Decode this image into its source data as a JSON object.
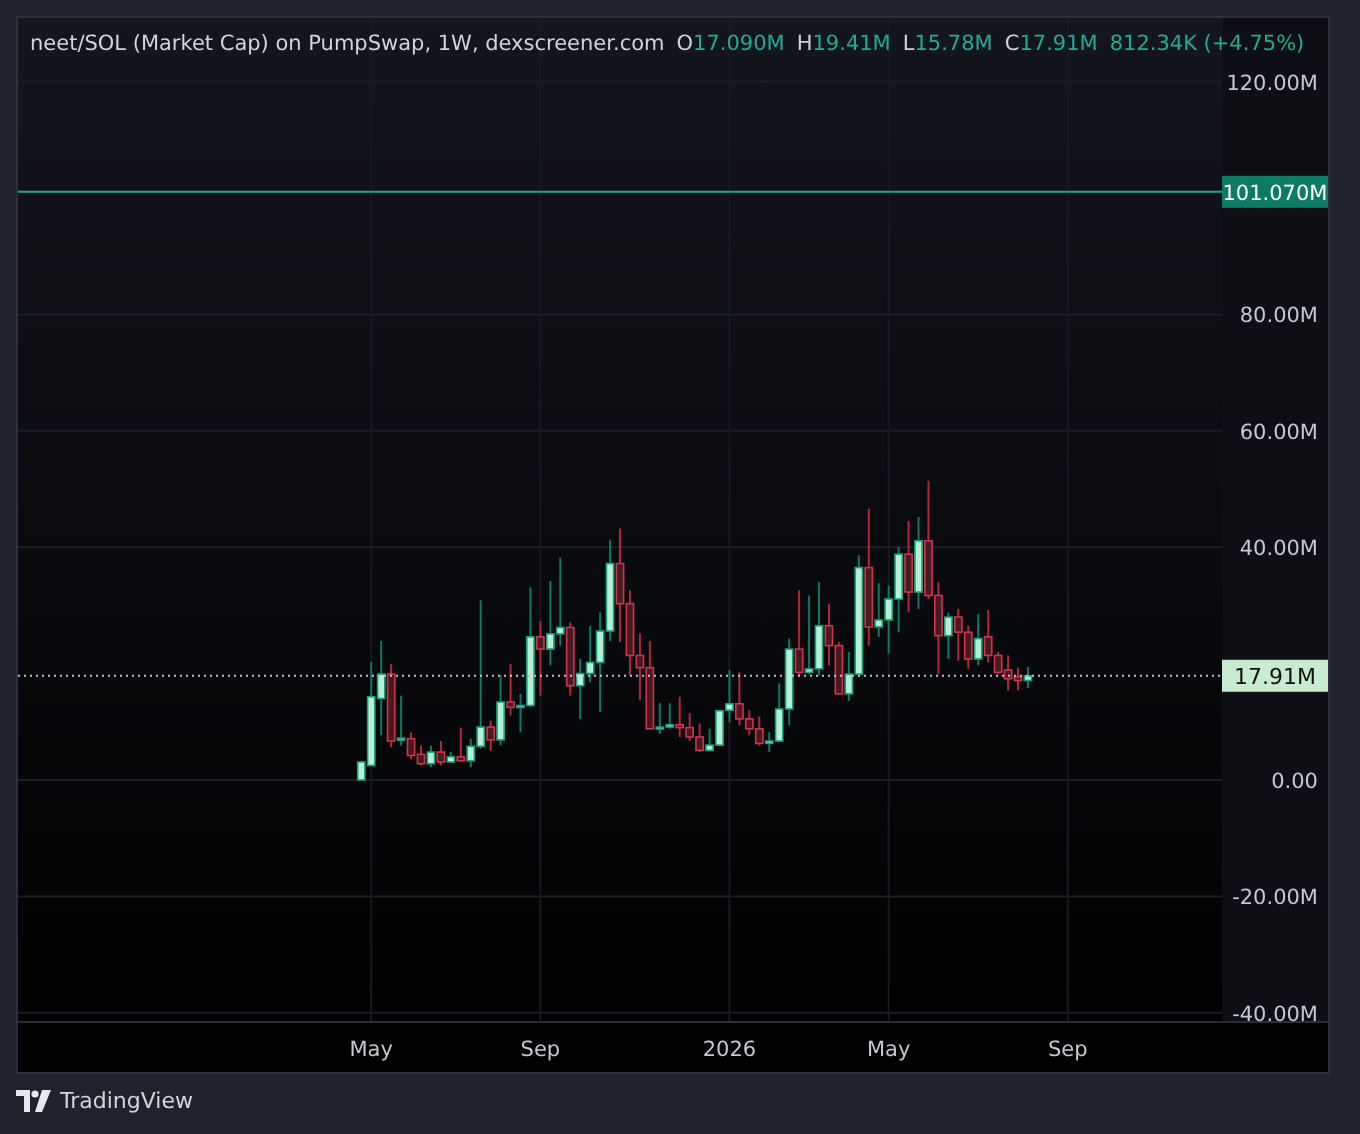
{
  "legend": {
    "title": "neet/SOL (Market Cap) on PumpSwap, 1W, dexscreener.com",
    "ohlc": [
      {
        "label": "O",
        "value": "17.090M"
      },
      {
        "label": "H",
        "value": "19.41M"
      },
      {
        "label": "L",
        "value": "15.78M"
      },
      {
        "label": "C",
        "value": "17.91M"
      }
    ],
    "change": "812.34K (+4.75%)"
  },
  "chart_data": {
    "type": "candlestick",
    "grid": true,
    "ylim": [
      -41.58,
      130.93
    ],
    "yticks": [
      {
        "value": 120,
        "label": "120.00M"
      },
      {
        "value": 80,
        "label": "80.00M"
      },
      {
        "value": 60,
        "label": "60.00M"
      },
      {
        "value": 40,
        "label": "40.00M"
      },
      {
        "value": 0,
        "label": "0.00"
      },
      {
        "value": -20,
        "label": "-20.00M"
      },
      {
        "value": -40,
        "label": "-40.00M"
      }
    ],
    "categories": [
      null,
      null,
      null,
      null,
      null,
      null,
      null,
      null,
      null,
      null,
      null,
      null,
      null,
      null,
      null,
      null,
      null,
      null,
      null,
      null,
      null,
      null,
      null,
      null,
      null,
      null,
      null,
      null,
      null,
      null,
      null,
      null,
      null,
      null,
      null,
      "May",
      null,
      null,
      null,
      null,
      null,
      null,
      null,
      null,
      null,
      null,
      null,
      null,
      null,
      null,
      null,
      null,
      "Sep",
      null,
      null,
      null,
      null,
      null,
      null,
      null,
      null,
      null,
      null,
      null,
      null,
      null,
      null,
      null,
      null,
      null,
      null,
      "2026",
      null,
      null,
      null,
      null,
      null,
      null,
      null,
      null,
      null,
      null,
      null,
      null,
      null,
      null,
      null,
      "May",
      null,
      null,
      null,
      null,
      null,
      null,
      null,
      null,
      null,
      null,
      null,
      null,
      null,
      null,
      null,
      null,
      null,
      "Sep",
      null,
      null,
      null,
      null,
      null,
      null,
      null,
      null,
      null,
      null,
      null,
      null,
      null,
      null,
      null
    ],
    "ohlc": [
      null,
      null,
      null,
      null,
      null,
      null,
      null,
      null,
      null,
      null,
      null,
      null,
      null,
      null,
      null,
      null,
      null,
      null,
      null,
      null,
      null,
      null,
      null,
      null,
      null,
      null,
      null,
      null,
      null,
      null,
      null,
      null,
      null,
      null,
      [
        0,
        3.3,
        0,
        3.1
      ],
      [
        2.5,
        20.3,
        2.5,
        14.3
      ],
      [
        14,
        23.9,
        7.7,
        18.2
      ],
      [
        18.2,
        19.9,
        5.6,
        6.7
      ],
      [
        7.1,
        14.5,
        5.9,
        7.2
      ],
      [
        7.1,
        8.2,
        3.6,
        4.2
      ],
      [
        4.4,
        5.9,
        2.5,
        2.8
      ],
      [
        2.8,
        5.9,
        2.2,
        4.8
      ],
      [
        4.8,
        6.7,
        2.5,
        3.1
      ],
      [
        3.1,
        4.8,
        2.9,
        4
      ],
      [
        4,
        9,
        3.1,
        3.3
      ],
      [
        3.3,
        7.1,
        2.2,
        5.8
      ],
      [
        5.8,
        30.9,
        5.4,
        9.1
      ],
      [
        9.1,
        10.2,
        5,
        6.9
      ],
      [
        6.9,
        18,
        6,
        13.4
      ],
      [
        13.4,
        19.9,
        11.1,
        12.5
      ],
      [
        12.5,
        14.8,
        8.2,
        12.8
      ],
      [
        12.8,
        33.1,
        12.5,
        24.6
      ],
      [
        24.6,
        27.3,
        14.5,
        22.5
      ],
      [
        22.5,
        34.2,
        19.7,
        25.1
      ],
      [
        25.1,
        38.2,
        23.1,
        26.2
      ],
      [
        26.2,
        27.1,
        14.5,
        16.2
      ],
      [
        16.2,
        20.8,
        10.5,
        18.3
      ],
      [
        18.3,
        26.5,
        16.8,
        20.2
      ],
      [
        20.2,
        28.8,
        11.7,
        25.6
      ],
      [
        25.6,
        41.2,
        23.9,
        37.2
      ],
      [
        37.2,
        43.2,
        23.7,
        30.3
      ],
      [
        30.3,
        32.6,
        18,
        21.4
      ],
      [
        21.4,
        25.2,
        13.7,
        19.3
      ],
      [
        19.3,
        23.9,
        8.8,
        8.8
      ],
      [
        8.8,
        13.2,
        7.9,
        9.1
      ],
      [
        9.1,
        13.2,
        8.8,
        9.5
      ],
      [
        9.5,
        14.3,
        7.4,
        9
      ],
      [
        9,
        11.5,
        6.7,
        7.4
      ],
      [
        7.4,
        9.7,
        4.8,
        5.1
      ],
      [
        5.1,
        8.8,
        4.9,
        6
      ],
      [
        6,
        12,
        5.9,
        11.9
      ],
      [
        12,
        18.9,
        9.9,
        13.1
      ],
      [
        13.1,
        18.5,
        9.4,
        10.5
      ],
      [
        10.5,
        12,
        7.7,
        8.8
      ],
      [
        8.8,
        10.9,
        5.9,
        6.3
      ],
      [
        6.3,
        8.2,
        4.8,
        6.7
      ],
      [
        6.7,
        16.6,
        6.5,
        12.2
      ],
      [
        12.2,
        24.3,
        9.4,
        22.5
      ],
      [
        22.5,
        32.6,
        18,
        18.5
      ],
      [
        18.5,
        31.7,
        18.2,
        19.1
      ],
      [
        19.1,
        34,
        18,
        26.5
      ],
      [
        26.5,
        30.3,
        19.7,
        23.1
      ],
      [
        23.1,
        23.7,
        14.8,
        14.8
      ],
      [
        14.8,
        22,
        13.6,
        18.2
      ],
      [
        18.2,
        38.6,
        18.2,
        36.5
      ],
      [
        36.5,
        46.6,
        23.1,
        26.3
      ],
      [
        26.3,
        33.8,
        24.6,
        27.5
      ],
      [
        27.5,
        33.4,
        21.7,
        31.1
      ],
      [
        31.1,
        40,
        25.4,
        38.8
      ],
      [
        38.8,
        44.5,
        28.8,
        32.3
      ],
      [
        32.3,
        45.2,
        29.4,
        41.1
      ],
      [
        41.1,
        51.4,
        31.1,
        31.7
      ],
      [
        31.7,
        34,
        18.2,
        24.8
      ],
      [
        24.8,
        28.8,
        20.8,
        28
      ],
      [
        28,
        29.4,
        20.5,
        25.4
      ],
      [
        25.4,
        26.5,
        19.1,
        20.8
      ],
      [
        20.8,
        28.5,
        19.7,
        24.3
      ],
      [
        24.6,
        29.2,
        20.2,
        21.4
      ],
      [
        21.4,
        22,
        18.2,
        18.5
      ],
      [
        18.9,
        21.4,
        15.4,
        17.4
      ],
      [
        17.7,
        19.3,
        15.4,
        17.1
      ],
      [
        17.1,
        19.4,
        15.8,
        17.9
      ],
      null,
      null,
      null,
      null,
      null,
      null,
      null,
      null,
      null,
      null,
      null,
      null,
      null,
      null,
      null,
      null,
      null,
      null,
      null
    ],
    "ref_lines": [
      {
        "axis": "y",
        "value": 101.07,
        "label": "101.070M"
      },
      {
        "axis": "y",
        "value": 17.91,
        "label": "17.91M"
      }
    ]
  },
  "footer": {
    "brand": "TradingView"
  }
}
